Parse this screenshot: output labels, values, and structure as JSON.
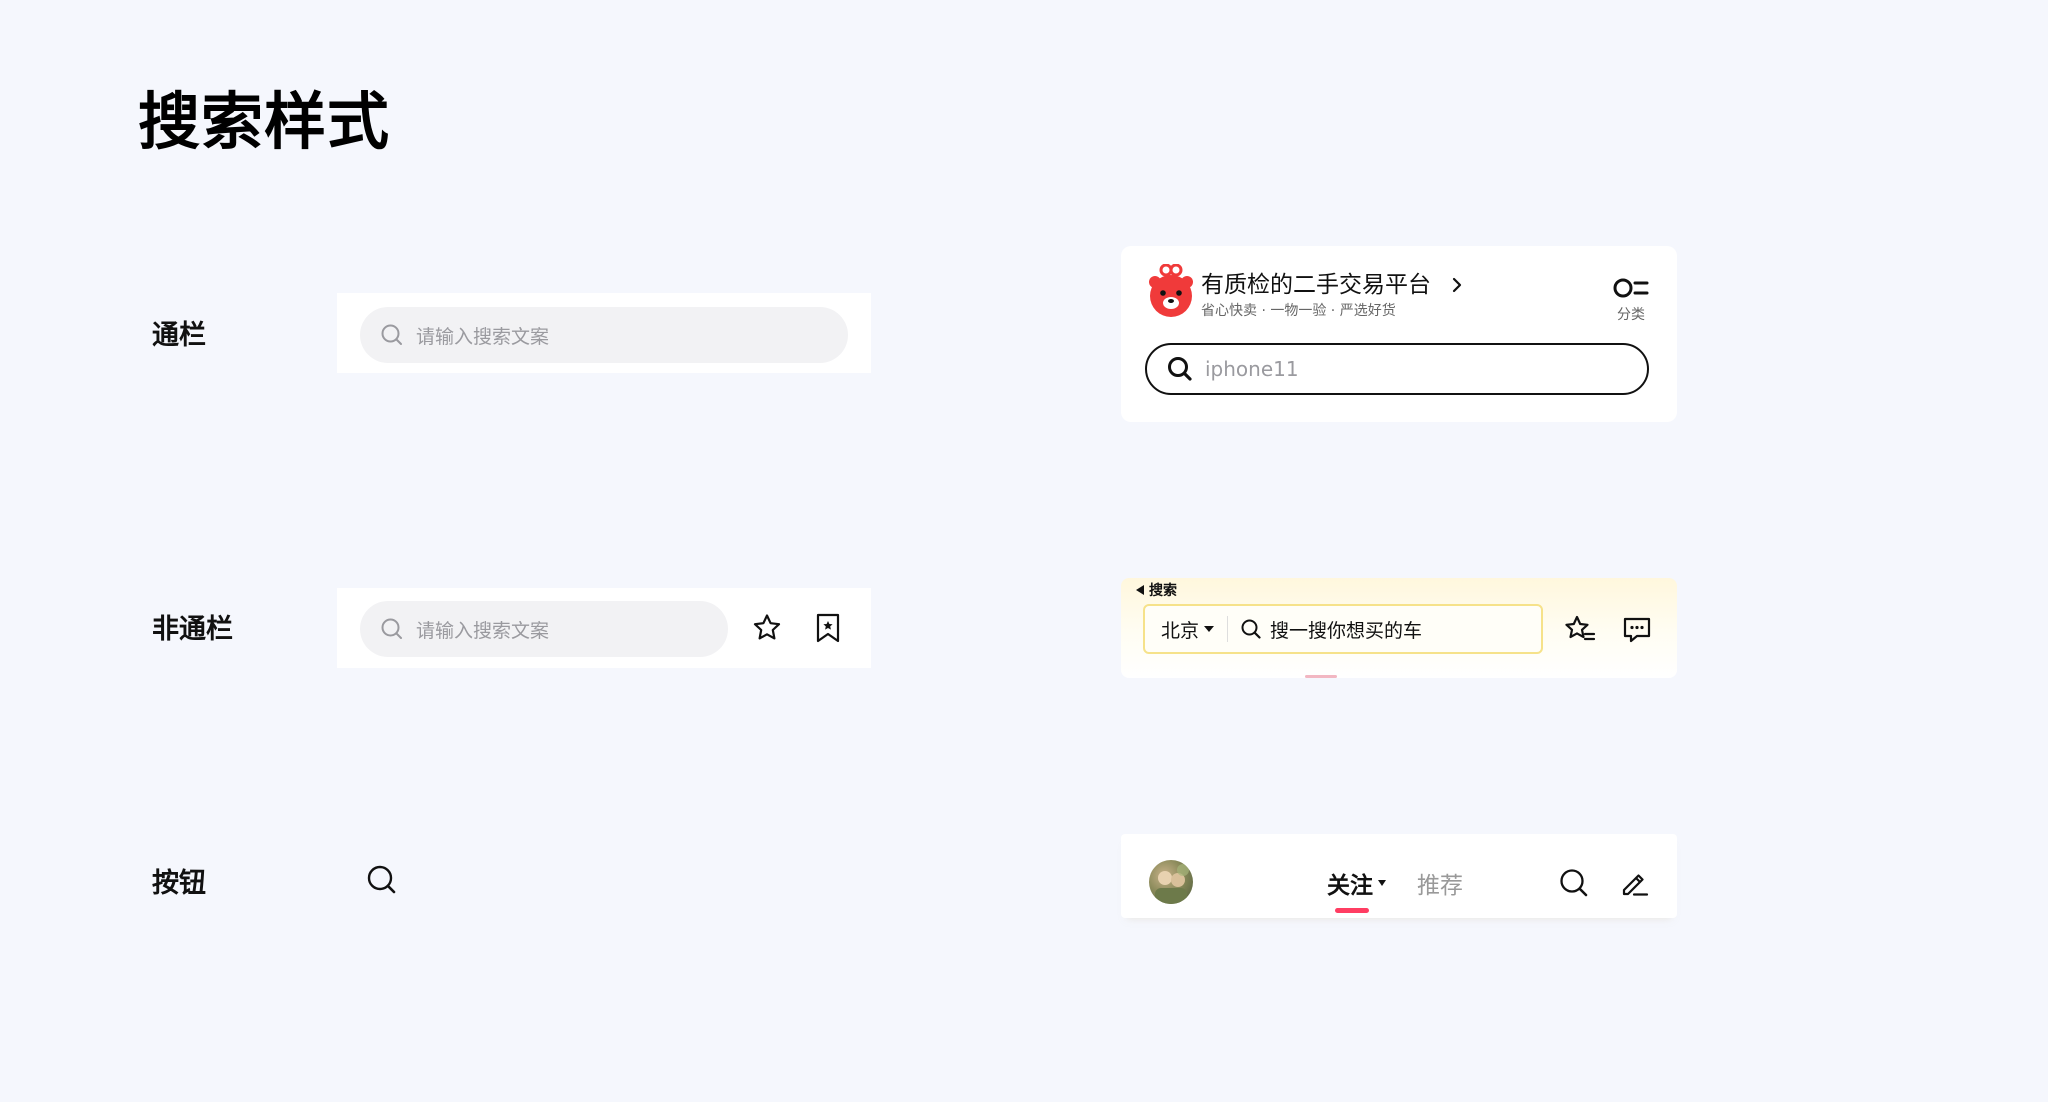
{
  "page": {
    "title": "搜索样式"
  },
  "rows": {
    "fullbar_label": "通栏",
    "nonfullbar_label": "非通栏",
    "button_label": "按钮"
  },
  "fullbar": {
    "placeholder": "请输入搜索文案",
    "icon": "search-icon"
  },
  "nonfullbar": {
    "placeholder": "请输入搜索文案",
    "icons": [
      "star-icon",
      "bookmark-icon"
    ]
  },
  "button_demo": {
    "icon": "search-icon"
  },
  "example1": {
    "title": "有质检的二手交易平台",
    "subtitle": "省心快卖 · 一物一验 · 严选好货",
    "category_label": "分类",
    "search_value": "iphone11",
    "colors": {
      "logo": "#f03a3a"
    }
  },
  "example2": {
    "back_label": "搜索",
    "city": "北京",
    "search_placeholder": "搜一搜你想买的车",
    "icons": [
      "star-list-icon",
      "message-icon"
    ],
    "colors": {
      "border": "#f6e28a",
      "background": "#fff7dd"
    }
  },
  "example3": {
    "tab_follow": "关注",
    "tab_recommend": "推荐",
    "icons": [
      "search-icon",
      "edit-icon"
    ],
    "colors": {
      "active_indicator": "#ff3d62"
    }
  }
}
